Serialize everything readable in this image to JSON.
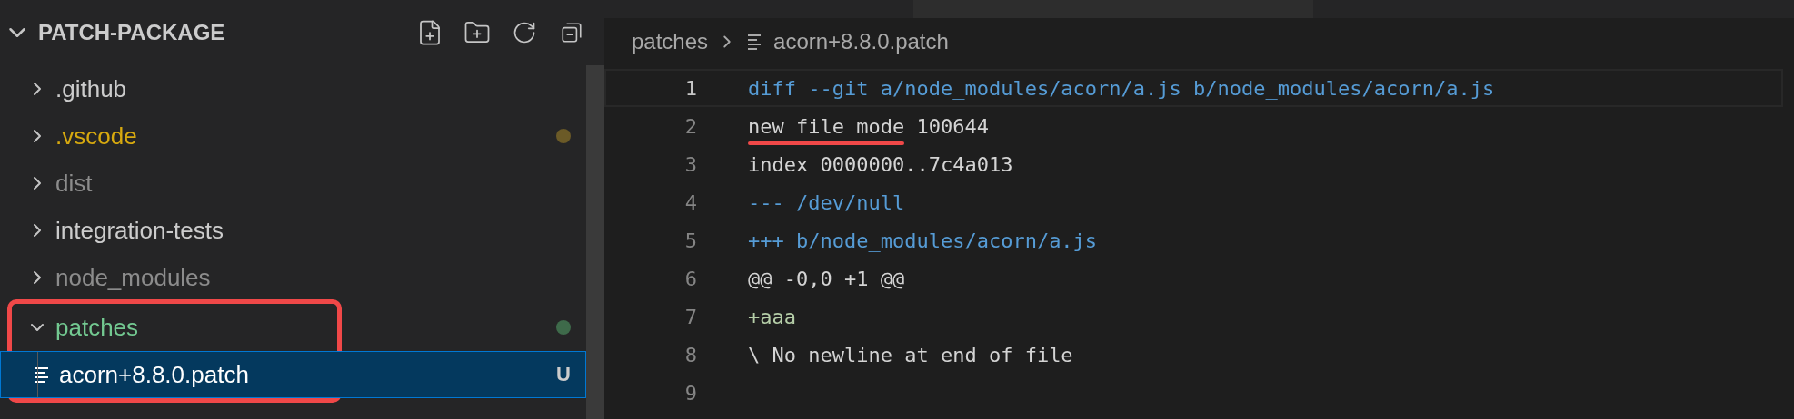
{
  "explorer": {
    "title": "PATCH-PACKAGE",
    "expanded": true,
    "items": [
      {
        "label": ".github",
        "kind": "normal",
        "expanded": false,
        "selected": false
      },
      {
        "label": ".vscode",
        "kind": "modified",
        "expanded": false,
        "selected": false
      },
      {
        "label": "dist",
        "kind": "ignored",
        "expanded": false,
        "selected": false
      },
      {
        "label": "integration-tests",
        "kind": "normal",
        "expanded": false,
        "selected": false
      },
      {
        "label": "node_modules",
        "kind": "ignored",
        "expanded": false,
        "selected": false
      },
      {
        "label": "patches",
        "kind": "untracked",
        "expanded": true,
        "selected": false,
        "annotated": true,
        "children": [
          {
            "label": "acorn+8.8.0.patch",
            "badge": "U",
            "selected": true
          }
        ]
      }
    ]
  },
  "breadcrumb": [
    "patches",
    "acorn+8.8.0.patch"
  ],
  "editor": {
    "lines": [
      {
        "number": "1",
        "text": "diff --git a/node_modules/acorn/a.js b/node_modules/acorn/a.js",
        "kind": "header",
        "current": true
      },
      {
        "number": "2",
        "text": "new file mode 100644",
        "kind": "plain",
        "annotated": true
      },
      {
        "number": "3",
        "text": "index 0000000..7c4a013",
        "kind": "plain"
      },
      {
        "number": "4",
        "text": "--- /dev/null",
        "kind": "header"
      },
      {
        "number": "5",
        "text": "+++ b/node_modules/acorn/a.js",
        "kind": "header"
      },
      {
        "number": "6",
        "text": "@@ -0,0 +1 @@",
        "kind": "plain"
      },
      {
        "number": "7",
        "text": "+aaa",
        "kind": "added"
      },
      {
        "number": "8",
        "text": "\\ No newline at end of file",
        "kind": "plain"
      },
      {
        "number": "9"
      }
    ]
  }
}
